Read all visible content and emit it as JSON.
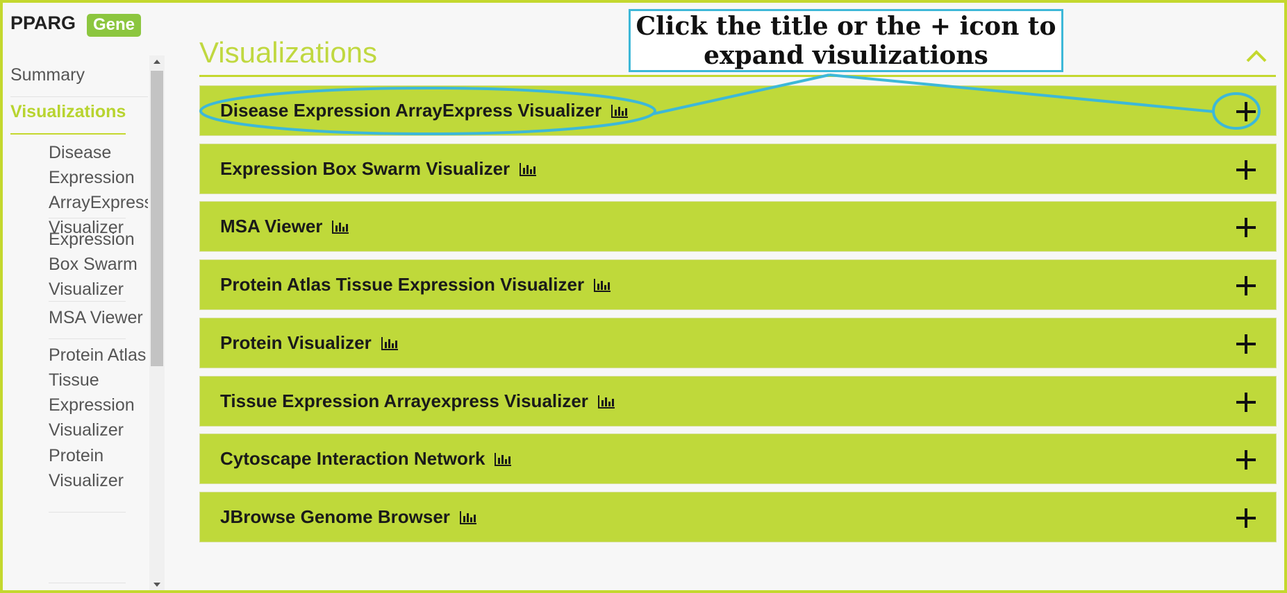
{
  "gene": {
    "symbol": "PPARG",
    "badge": "Gene"
  },
  "sidebar": {
    "items": [
      {
        "label": "Summary"
      },
      {
        "label": "Visualizations"
      }
    ],
    "subitems": [
      {
        "label": "Disease Expression ArrayExpress Visualizer"
      },
      {
        "label": "Expression Box Swarm Visualizer"
      },
      {
        "label": "MSA Viewer"
      },
      {
        "label": "Protein Atlas Tissue Expression Visualizer"
      },
      {
        "label": "Protein Visualizer"
      }
    ]
  },
  "main": {
    "section_title": "Visualizations",
    "panels": [
      {
        "title": "Disease Expression ArrayExpress Visualizer",
        "icon": "bar-chart-icon"
      },
      {
        "title": "Expression Box Swarm Visualizer",
        "icon": "bar-chart-icon"
      },
      {
        "title": "MSA Viewer",
        "icon": "bar-chart-icon"
      },
      {
        "title": "Protein Atlas Tissue Expression Visualizer",
        "icon": "bar-chart-icon"
      },
      {
        "title": "Protein Visualizer",
        "icon": "bar-chart-icon"
      },
      {
        "title": "Tissue Expression Arrayexpress Visualizer",
        "icon": "bar-chart-icon"
      },
      {
        "title": "Cytoscape Interaction Network",
        "icon": "bar-chart-icon"
      },
      {
        "title": "JBrowse Genome Browser",
        "icon": "bar-chart-icon"
      }
    ]
  },
  "callout": {
    "line1": "Click the title or the + icon to",
    "line2": "expand visulizations"
  },
  "colors": {
    "accent": "#c4d82e",
    "panel_bg": "#bfd93a",
    "badge_bg": "#8cc63f",
    "callout_border": "#3db8d8",
    "page_bg": "#f7f7f7"
  }
}
